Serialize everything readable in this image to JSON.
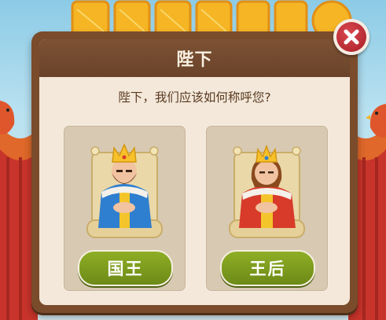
{
  "background": {
    "sky_color": "#b9e1f0",
    "title_color": "#f5b524"
  },
  "dialog": {
    "title": "陛下",
    "prompt": "陛下，我们应该如何称呼您?",
    "close_icon": "close-icon",
    "choices": [
      {
        "label": "国王",
        "figure": "king-icon",
        "robe_color": "#2f7fd0"
      },
      {
        "label": "王后",
        "figure": "queen-icon",
        "robe_color": "#d83b2a"
      }
    ],
    "button_color": "#7c9b1c"
  }
}
